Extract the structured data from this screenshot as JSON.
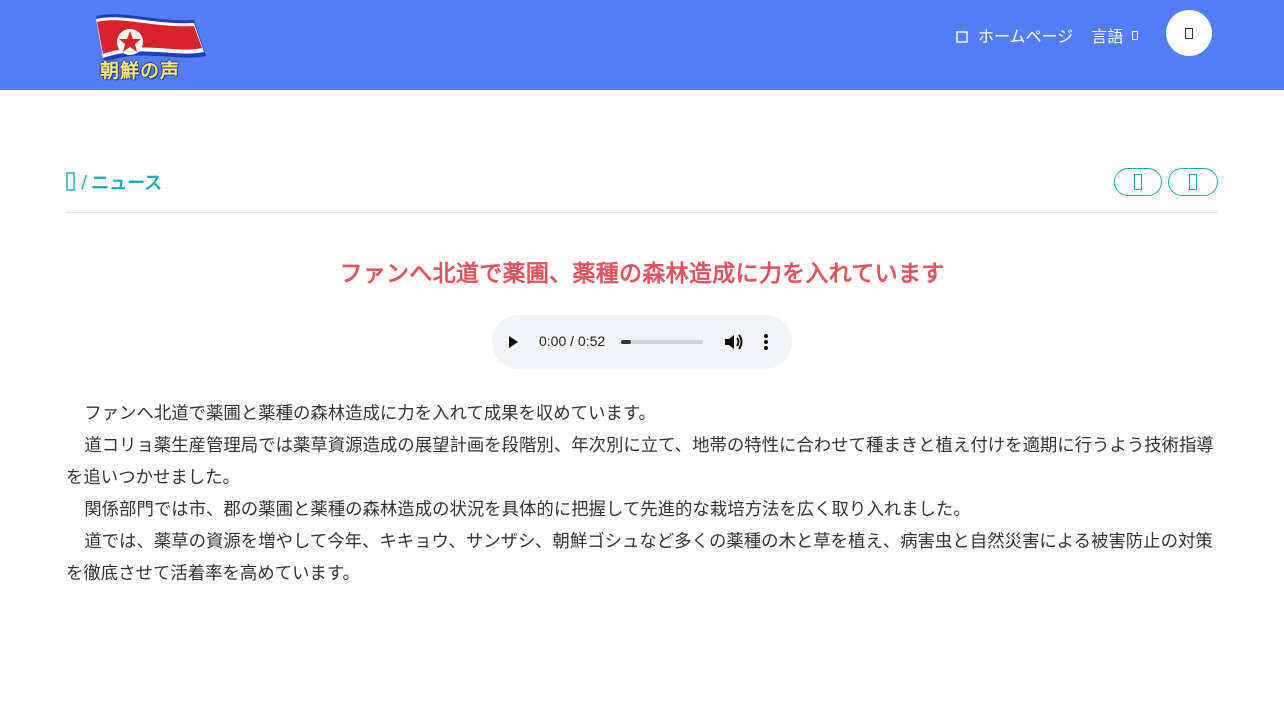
{
  "header": {
    "logo_text": "朝鮮の声",
    "nav": {
      "home_label": "ホームページ",
      "lang_label": "言語"
    },
    "icons": {
      "home": "home-icon",
      "lang_caret": "caret-down-icon",
      "circle_button": "search-icon"
    }
  },
  "breadcrumb": {
    "separator": "/",
    "current": "ニュース"
  },
  "article": {
    "title": "ファンへ北道で薬圃、薬種の森林造成に力を入れています",
    "audio": {
      "time": "0:00 / 0:52",
      "progress_fraction": 0.12
    },
    "paragraphs": [
      "ファンへ北道で薬圃と薬種の森林造成に力を入れて成果を収めています。",
      "道コリョ薬生産管理局では薬草資源造成の展望計画を段階別、年次別に立て、地帯の特性に合わせて種まきと植え付けを適期に行うよう技術指導を追いつかせました。",
      "関係部門では市、郡の薬圃と薬種の森林造成の状況を具体的に把握して先進的な栽培方法を広く取り入れました。",
      "道では、薬草の資源を増やして今年、キキョウ、サンザシ、朝鮮ゴシュなど多くの薬種の木と草を植え、病害虫と自然災害による被害防止の対策を徹底させて活着率を高めています。"
    ]
  },
  "colors": {
    "navbar": "#537df6",
    "accent": "#1aa9b5",
    "title": "#e0535f"
  }
}
